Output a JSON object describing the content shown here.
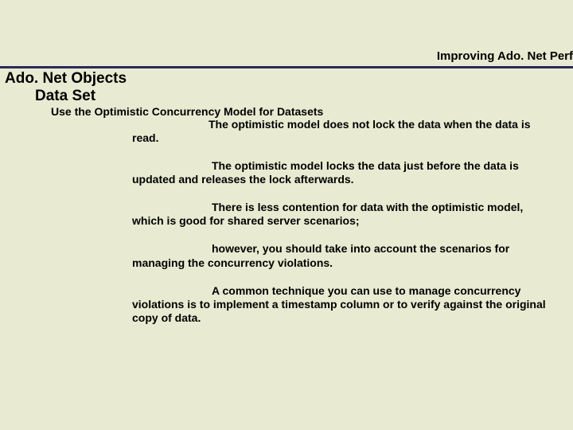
{
  "header": {
    "right_title": "Improving Ado. Net Perf"
  },
  "title": {
    "line1": "Ado. Net Objects",
    "line2": "Data Set"
  },
  "subheading": "Use the Optimistic Concurrency Model for Datasets",
  "paragraphs": {
    "p1": "The optimistic model does not lock the data when the data is read.",
    "p2": "The optimistic model locks the data just before the data is updated and releases the lock afterwards.",
    "p3": "There is less contention for data with the optimistic model, which is good for shared server scenarios;",
    "p4": "however, you should take into account the scenarios for managing the concurrency violations.",
    "p5": "A common technique you can use to manage concurrency violations is to implement a timestamp column or to verify  against the original copy of data."
  }
}
